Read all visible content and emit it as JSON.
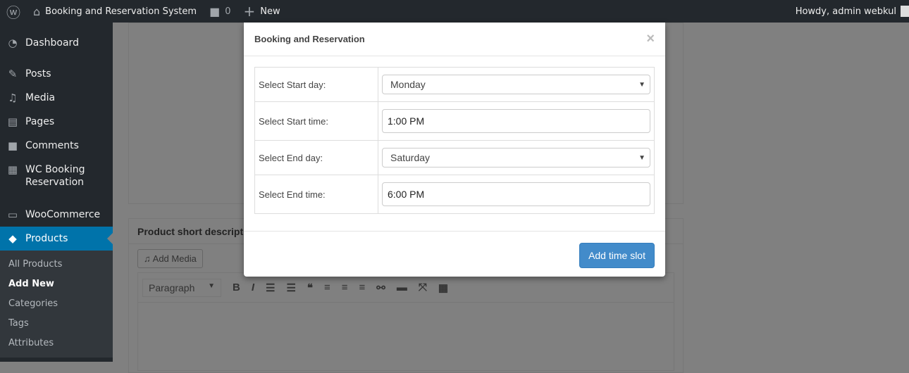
{
  "adminbar": {
    "site_title": "Booking and Reservation System",
    "comments_count": "0",
    "new_label": "New",
    "howdy": "Howdy, admin webkul"
  },
  "sidebar": {
    "items": [
      {
        "label": "Dashboard",
        "icon": "dashboard-icon"
      },
      {
        "label": "Posts",
        "icon": "pin-icon"
      },
      {
        "label": "Media",
        "icon": "media-icon"
      },
      {
        "label": "Pages",
        "icon": "pages-icon"
      },
      {
        "label": "Comments",
        "icon": "comment-icon"
      },
      {
        "label": "WC Booking Reservation",
        "icon": "calendar-icon"
      },
      {
        "label": "WooCommerce",
        "icon": "woo-icon"
      },
      {
        "label": "Products",
        "icon": "box-icon"
      }
    ],
    "submenu": [
      "All Products",
      "Add New",
      "Categories",
      "Tags",
      "Attributes"
    ]
  },
  "background": {
    "short_desc_title": "Product short description",
    "add_media": "Add Media",
    "format_select": "Paragraph"
  },
  "modal": {
    "title": "Booking and Reservation",
    "close": "×",
    "rows": [
      {
        "label": "Select Start day:",
        "value": "Monday",
        "type": "select"
      },
      {
        "label": "Select Start time:",
        "value": "1:00 PM",
        "type": "input"
      },
      {
        "label": "Select End day:",
        "value": "Saturday",
        "type": "select"
      },
      {
        "label": "Select End time:",
        "value": "6:00 PM",
        "type": "input"
      }
    ],
    "submit": "Add time slot"
  }
}
